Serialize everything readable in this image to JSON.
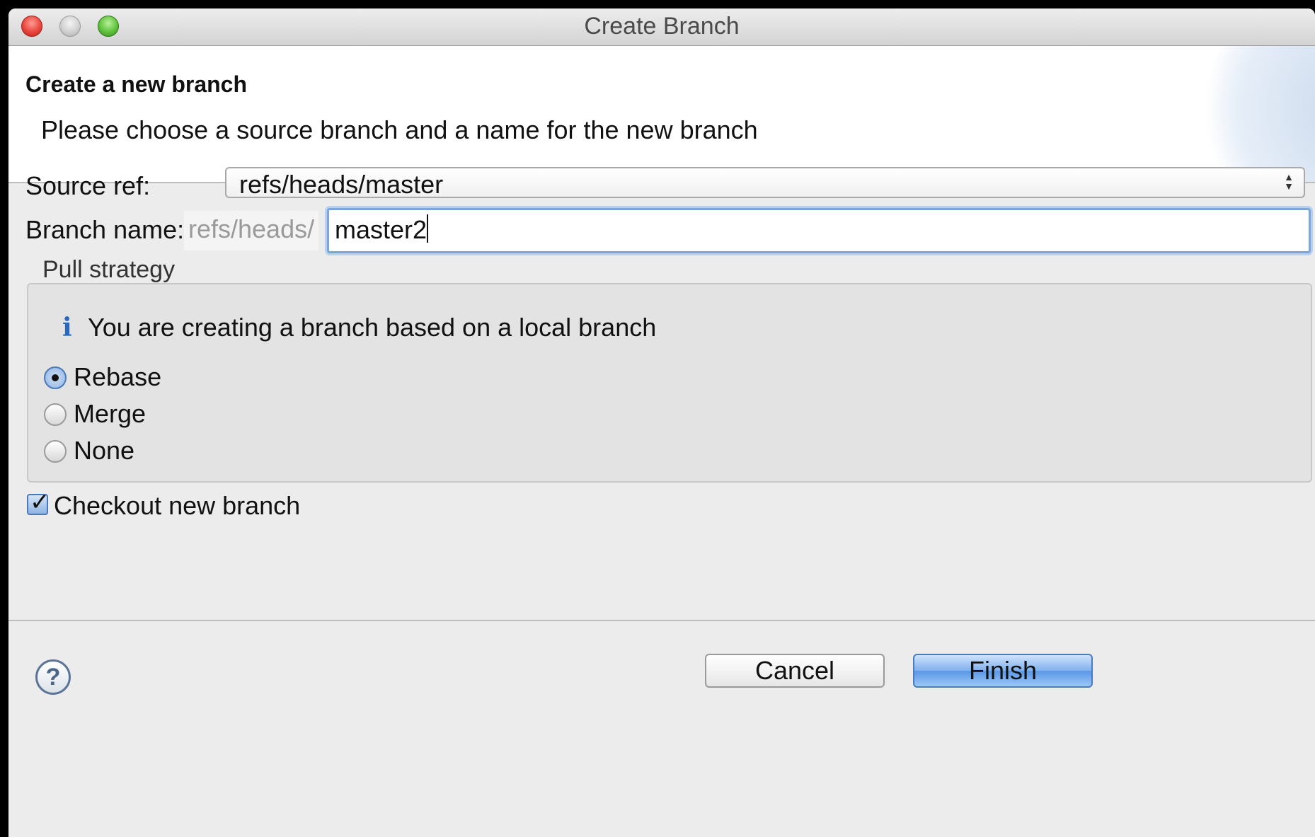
{
  "window": {
    "title": "Create Branch"
  },
  "header": {
    "title": "Create a new branch",
    "description": "Please choose a source branch and a name for the new branch"
  },
  "form": {
    "source_ref_label": "Source ref:",
    "source_ref_value": "refs/heads/master",
    "branch_name_label": "Branch name:",
    "branch_prefix": "refs/heads/",
    "branch_name_value": "master2"
  },
  "pull_strategy": {
    "label": "Pull strategy",
    "info": "You are creating a branch based on a local branch",
    "options": [
      {
        "label": "Rebase",
        "checked": true
      },
      {
        "label": "Merge",
        "checked": false
      },
      {
        "label": "None",
        "checked": false
      }
    ]
  },
  "checkout": {
    "label": "Checkout new branch",
    "checked": true
  },
  "footer": {
    "help_label": "?",
    "cancel_label": "Cancel",
    "finish_label": "Finish"
  }
}
